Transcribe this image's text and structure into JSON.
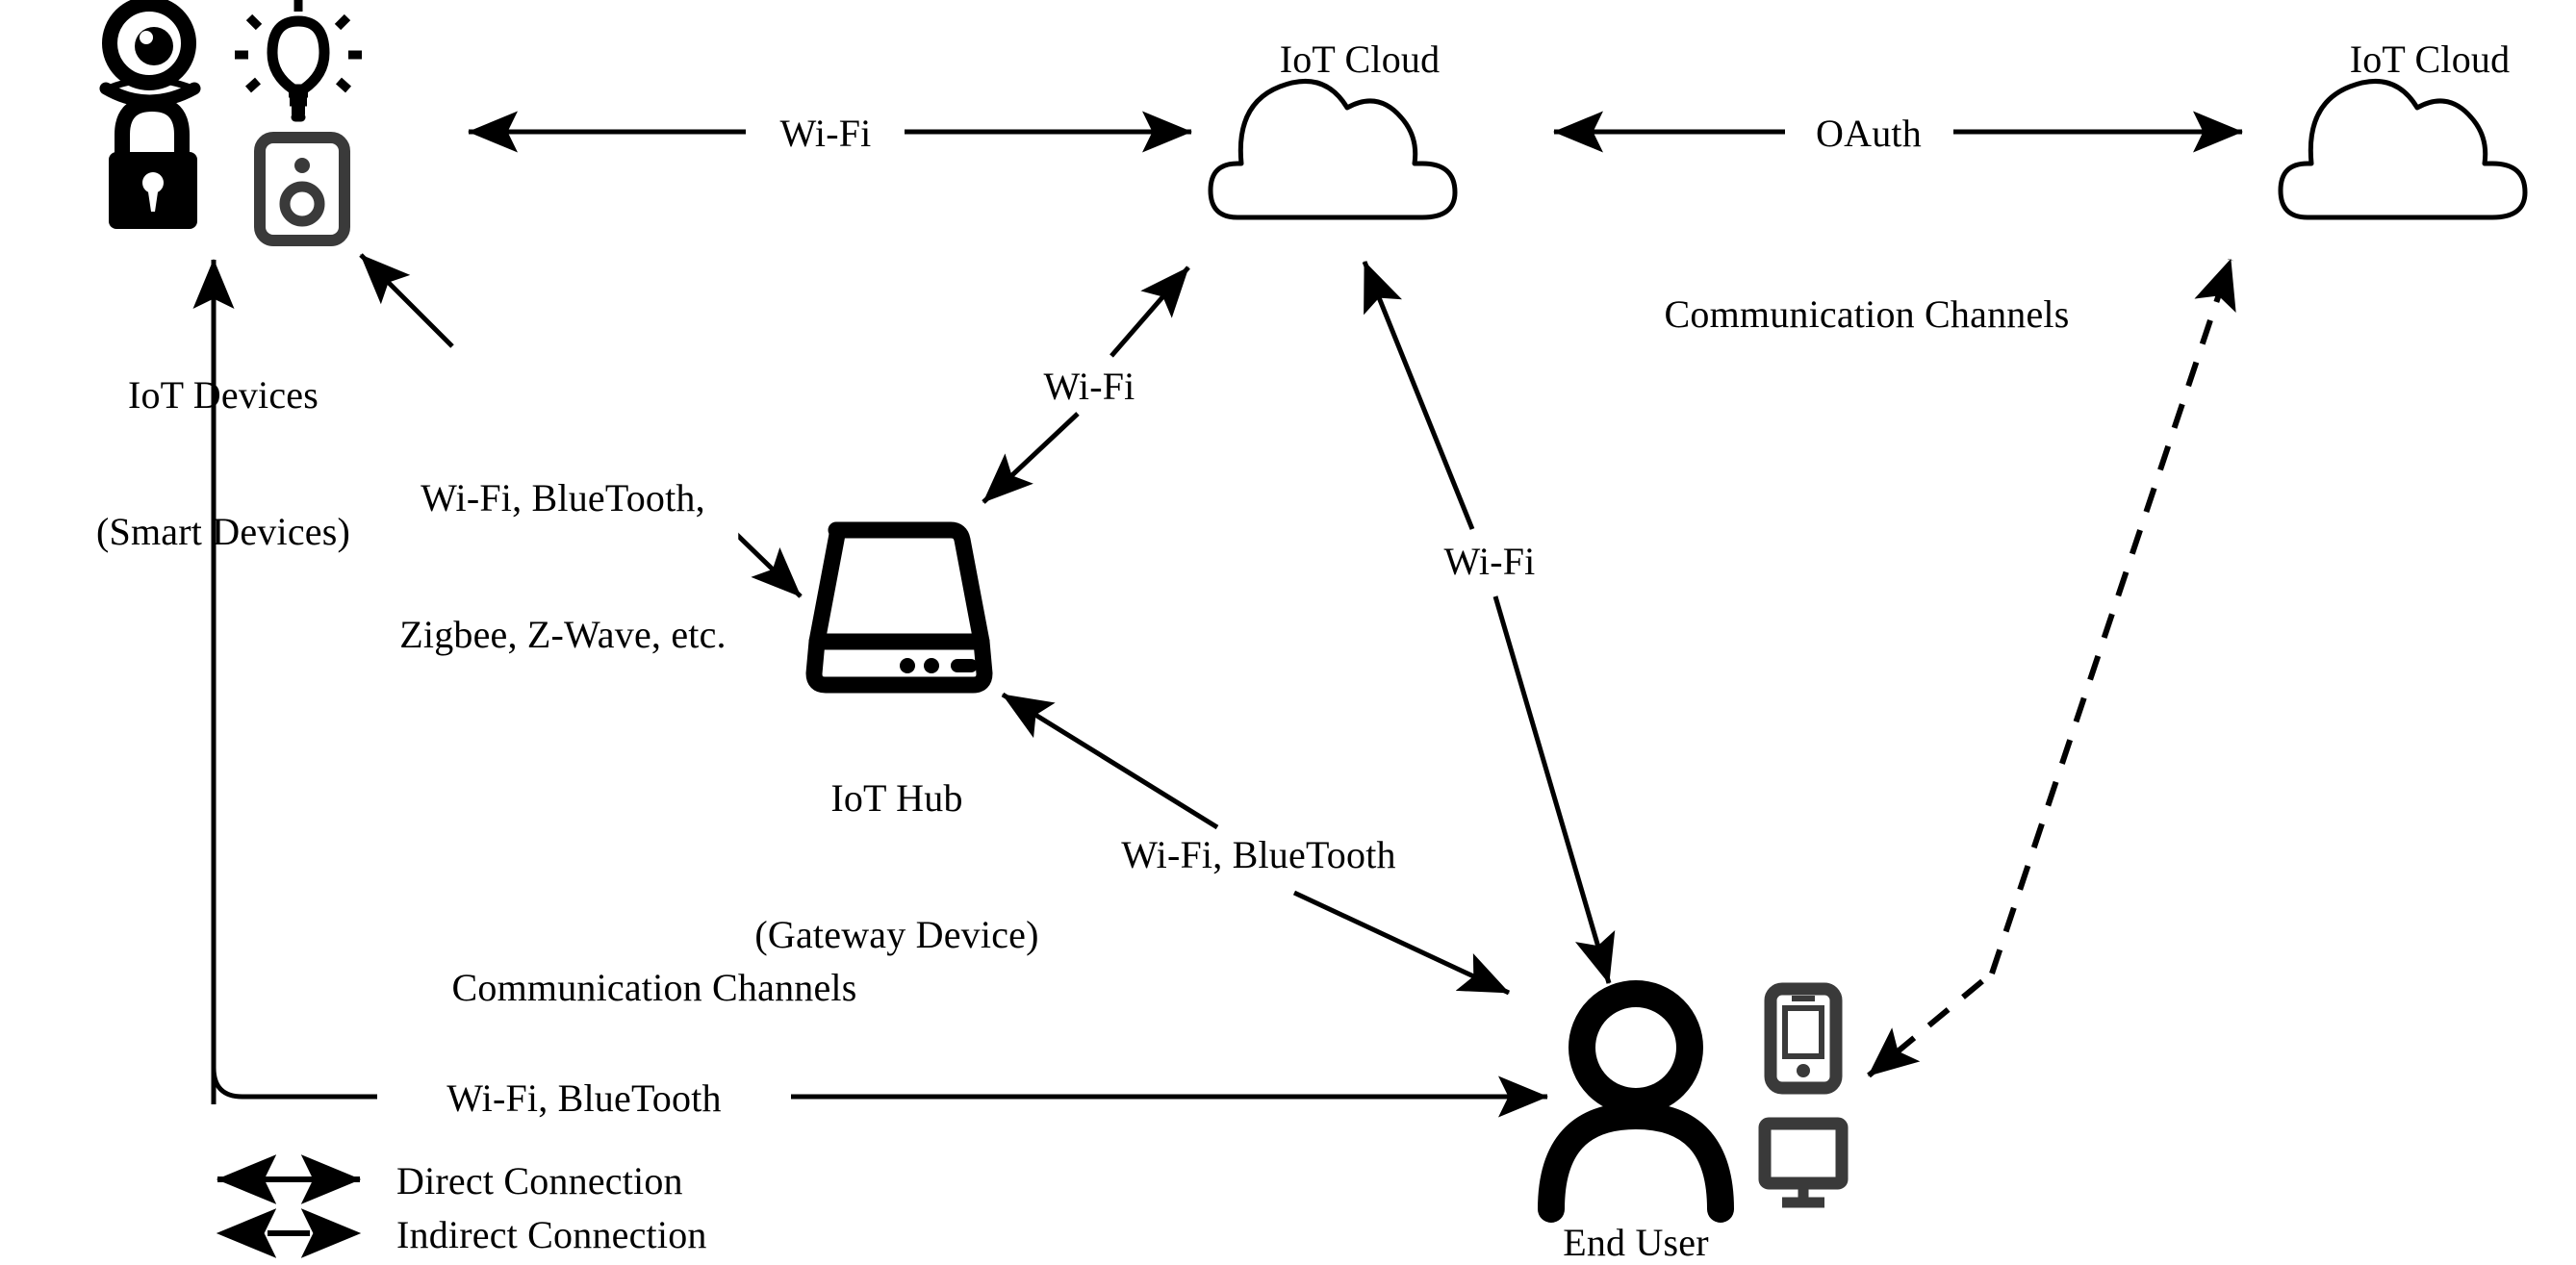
{
  "diagram": {
    "title": "IoT Architecture Communication Diagram",
    "nodes": {
      "iot_devices": {
        "label_line1": "IoT Devices",
        "label_line2": "(Smart Devices)",
        "icons": [
          "camera-icon",
          "lightbulb-icon",
          "padlock-icon",
          "doorbell-icon"
        ]
      },
      "iot_cloud_left": {
        "label": "IoT Cloud",
        "icon": "cloud-icon"
      },
      "iot_cloud_right": {
        "label": "IoT Cloud",
        "icon": "cloud-icon"
      },
      "iot_hub": {
        "label_line1": "IoT Hub",
        "label_line2": "(Gateway Device)",
        "icon": "hub-device-icon"
      },
      "end_user": {
        "label": "End User",
        "icons": [
          "person-icon",
          "smartphone-icon",
          "monitor-icon"
        ]
      }
    },
    "edges": {
      "devices_to_cloud": "Wi-Fi",
      "cloud_to_cloud": "OAuth",
      "devices_to_hub_line1": "Wi-Fi, BlueTooth,",
      "devices_to_hub_line2": "Zigbee, Z-Wave, etc.",
      "hub_to_cloud": "Wi-Fi",
      "cloud_to_user": "Wi-Fi",
      "hub_to_user": "Wi-Fi, BlueTooth",
      "devices_to_user": "Wi-Fi, BlueTooth"
    },
    "section_labels": {
      "upper_right": "Communication Channels",
      "lower_left": "Communication Channels"
    },
    "legend": {
      "direct": "Direct Connection",
      "indirect": "Indirect Connection"
    },
    "colors": {
      "stroke": "#000000",
      "icon": "#1b1b1b",
      "background": "#ffffff"
    }
  }
}
